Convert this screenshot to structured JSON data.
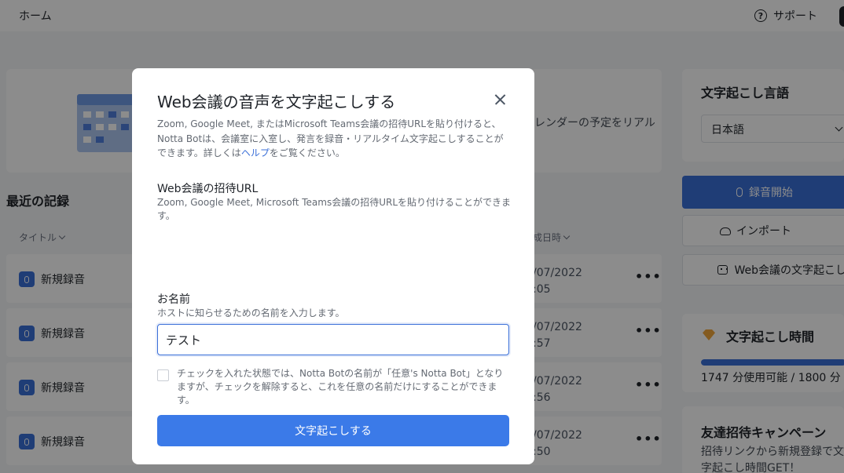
{
  "topbar": {
    "home": "ホーム",
    "support": "サポート"
  },
  "banner": {
    "text": "レンダーの予定をリアル"
  },
  "recent": {
    "title": "最近の記録",
    "col_title": "タイトル",
    "col_date": "成日時",
    "rows": [
      {
        "name": "新規録音",
        "date": "/07/2022",
        "time": ":05"
      },
      {
        "name": "新規録音",
        "date": "/07/2022",
        "time": ":57"
      },
      {
        "name": "新規録音",
        "date": "/07/2022",
        "time": ":56"
      },
      {
        "name": "新規録音",
        "date": "/07/2022",
        "time": ":50"
      }
    ]
  },
  "side": {
    "lang_title": "文字起こし言語",
    "lang_value": "日本語",
    "record_btn": "録音開始",
    "import_btn": "インポート",
    "web_btn": "Web会議の文字起こし",
    "time_title": "文字起こし時間",
    "time_used_fraction": 0.97,
    "time_usage": "1747 分使用可能 / 1800 分",
    "invite_title": "友達招待キャンペーン",
    "invite_desc": "招待リンクから新規登録で文字起こし時間GET！"
  },
  "modal": {
    "title": "Web会議の音声を文字起こしする",
    "intro_before": "Zoom, Google Meet, またはMicrosoft Teams会議の招待URLを貼り付けると、Notta Botは、会議室に入室し、発言を録音・リアルタイム文字起こしすることができます。詳しくは",
    "intro_link": "ヘルプ",
    "intro_after": "をご覧ください。",
    "url_label": "Web会議の招待URL",
    "url_desc": "Zoom, Google Meet, Microsoft Teams会議の招待URLを貼り付けることができます。",
    "name_label": "お名前",
    "name_desc": "ホストに知らせるための名前を入力します。",
    "name_value": "テスト",
    "check_text": "チェックを入れた状態では、Notta Botの名前が「任意's Notta Bot」となりますが、チェックを解除すると、これを任意の名前だけにすることができます。",
    "submit": "文字起こしする"
  },
  "colors": {
    "primary": "#3a6fd8",
    "submit": "#3b7ae8"
  }
}
